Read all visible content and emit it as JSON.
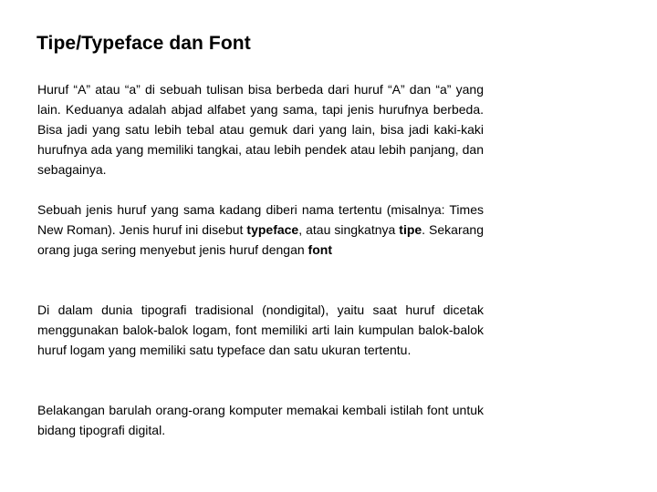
{
  "slide": {
    "title": "Tipe/Typeface dan Font",
    "paragraphs": [
      {
        "text": "Huruf “A” atau “a” di sebuah tulisan bisa berbeda dari huruf “A” dan “a” yang lain. Keduanya adalah abjad alfabet yang sama, tapi jenis hurufnya berbeda. Bisa jadi yang satu lebih tebal atau gemuk dari yang lain, bisa jadi kaki-kaki hurufnya ada yang memiliki tangkai, atau lebih pendek atau lebih panjang, dan sebagainya."
      },
      {
        "segments": {
          "s1": "Sebuah jenis huruf yang sama kadang diberi nama tertentu (misalnya: Times New Roman). Jenis huruf ini disebut ",
          "b1": "typeface",
          "s2": ", atau singkatnya ",
          "b2": "tipe",
          "s3": ". Sekarang orang juga sering menyebut jenis huruf dengan ",
          "b3": "font"
        }
      },
      {
        "text": "Di dalam dunia tipografi tradisional (nondigital), yaitu saat huruf dicetak menggunakan balok-balok logam, font memiliki arti lain kumpulan balok-balok huruf logam yang memiliki satu typeface dan satu ukuran tertentu."
      },
      {
        "text": "Belakangan barulah orang-orang komputer memakai kembali istilah font untuk bidang tipografi digital."
      }
    ]
  }
}
